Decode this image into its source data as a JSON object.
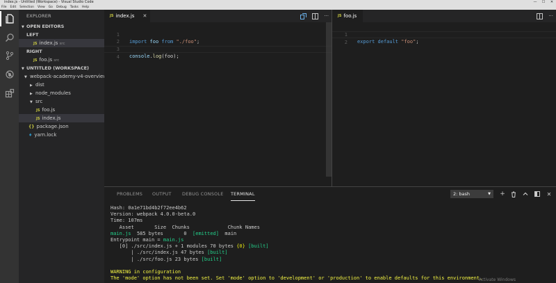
{
  "titlebar": {
    "title": "index.js - Untitled (Workspace) - Visual Studio Code",
    "minimize": "—",
    "maximize": "☐",
    "close": "✕"
  },
  "menu": [
    "File",
    "Edit",
    "Selection",
    "View",
    "Go",
    "Debug",
    "Tasks",
    "Help"
  ],
  "activity_icons": [
    "explorer-icon",
    "search-icon",
    "source-control-icon",
    "debug-icon",
    "extensions-icon"
  ],
  "sidebar": {
    "title": "EXPLORER",
    "open_editors": {
      "header": "OPEN EDITORS",
      "groups": [
        {
          "label": "LEFT",
          "file": "index.js",
          "dir": "src",
          "badge": "JS"
        },
        {
          "label": "RIGHT",
          "file": "foo.js",
          "dir": "src",
          "badge": "JS"
        }
      ]
    },
    "workspace": {
      "header": "UNTITLED (WORKSPACE)",
      "root": "webpack-academy-v4-overview",
      "items": [
        {
          "label": "dist",
          "type": "folder"
        },
        {
          "label": "node_modules",
          "type": "folder"
        },
        {
          "label": "src",
          "type": "folder-open"
        },
        {
          "label": "foo.js",
          "type": "js",
          "badge": "JS"
        },
        {
          "label": "index.js",
          "type": "js",
          "badge": "JS"
        },
        {
          "label": "package.json",
          "type": "json",
          "badge": "{}"
        },
        {
          "label": "yarn.lock",
          "type": "yarn",
          "badge": "♦"
        }
      ]
    }
  },
  "editor_left": {
    "tab": {
      "badge": "JS",
      "label": "index.js",
      "close": "✕"
    },
    "lines": [
      "1",
      "2",
      "3",
      "4"
    ],
    "code": {
      "l1": {
        "kw1": "import",
        "id": "foo",
        "kw2": "from",
        "str": "\"./foo\"",
        "end": ";"
      },
      "l3": {
        "obj": "console",
        "dot": ".",
        "fn": "log",
        "args": "(foo);"
      }
    }
  },
  "editor_right": {
    "tab": {
      "badge": "JS",
      "label": "foo.js"
    },
    "lines": [
      "1",
      "2"
    ],
    "code": {
      "kw1": "export",
      "kw2": "default",
      "str": "\"foo\"",
      "end": ";"
    }
  },
  "panel": {
    "tabs": [
      "PROBLEMS",
      "OUTPUT",
      "DEBUG CONSOLE",
      "TERMINAL"
    ],
    "active_tab": "TERMINAL",
    "terminal_select": "2: bash",
    "actions": {
      "add": "+",
      "trash": "trash-icon",
      "up": "^",
      "split": "split-icon",
      "close": "✕"
    },
    "terminal": {
      "hash": "Hash: 0a1e71bd4b2f72ee4b62",
      "version": "Version: webpack 4.0.0-beta.0",
      "time": "Time: 107ms",
      "table_header": "   Asset       Size  Chunks             Chunk Names",
      "asset_name": "main.js",
      "asset_rest_a": "  585 bytes       0  ",
      "asset_emitted": "[emitted]",
      "asset_rest_b": "  main",
      "entry_prefix": "Entrypoint main = ",
      "entry_file": "main.js",
      "mod0_prefix": "   [0] ./src/index.js + 1 modules 70 bytes ",
      "mod0_chunk": "{0}",
      "mod0_built": "[built]",
      "mod1_prefix": "       | ./src/index.js 47 bytes ",
      "mod1_built": "[built]",
      "mod2_prefix": "       | ./src/foo.js 23 bytes ",
      "mod2_built": "[built]",
      "warn1": "WARNING in configuration",
      "warn2": "The 'mode' option has not been set. Set 'mode' option to 'development' or 'production' to enable defaults for this environment."
    },
    "watermark": "Activate Windows"
  }
}
